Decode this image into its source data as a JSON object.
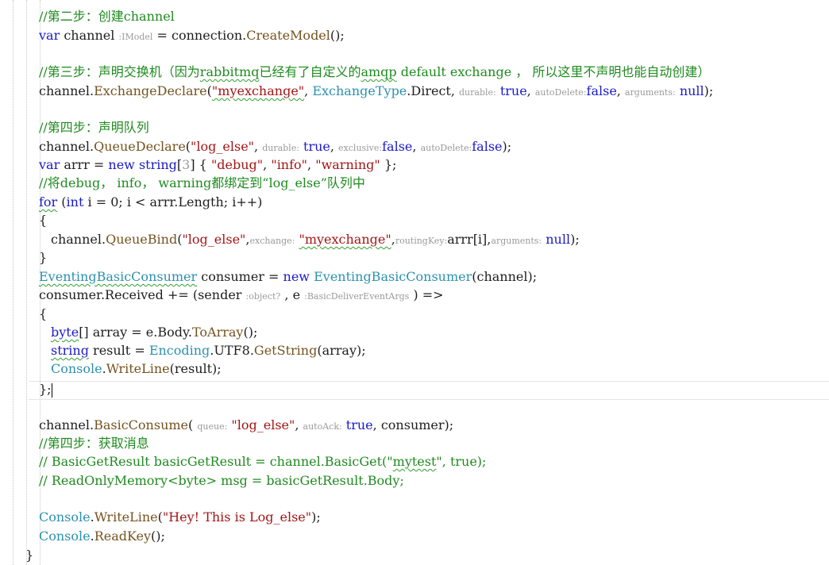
{
  "lines": [
    {
      "t": "//第二步：创建channel"
    },
    {
      "a": "var",
      "b": "channel",
      "c": ":IModel",
      "d": "=",
      "e": "connection",
      "f": "CreateModel",
      "g": "();"
    },
    {
      "t": "//第三步：声明交换机（因为rabbitmq已经有了自定义的amqp default exchange ， 所以这里不声明也能自动创建）",
      "sq1": "rabbitmq",
      "sq2": "amqp"
    },
    {
      "a": "channel",
      "f": "ExchangeDeclare",
      "s1": "\"myexchange\"",
      "ty": "ExchangeType",
      "d": "Direct",
      "h1": "durable:",
      "v1": "true",
      "h2": "autoDelete:",
      "v2": "false",
      "h3": "arguments:",
      "v3": "null"
    },
    {
      "t": "//第四步：声明队列"
    },
    {
      "a": "channel",
      "f": "QueueDeclare",
      "s1": "\"log_else\"",
      "h1": "durable:",
      "v1": "true",
      "h2": "exclusive:",
      "v2": "false",
      "h3": "autoDelete:",
      "v3": "false"
    },
    {
      "a": "var",
      "b": "arrr",
      "c": "new",
      "d": "string",
      "n": "3",
      "s1": "\"debug\"",
      "s2": "\"info\"",
      "s3": "\"warning\""
    },
    {
      "t": "//将debug， info， warning都绑定到“log_else”队列中"
    },
    {
      "a": "for",
      "b": "int",
      "c": "i",
      "n": "0",
      "d": "arrr",
      "e": "Length"
    },
    {
      "t": "{"
    },
    {
      "a": "channel",
      "f": "QueueBind",
      "s1": "\"log_else\"",
      "h1": "exchange:",
      "s2": "\"myexchange\"",
      "h2": "routingKey:",
      "d": "arrr[i]",
      "h3": "arguments:",
      "v3": "null"
    },
    {
      "t": "}"
    },
    {
      "ty": "EventingBasicConsumer",
      "b": "consumer",
      "c": "new",
      "d": "EventingBasicConsumer",
      "e": "channel"
    },
    {
      "a": "consumer",
      "b": "Received",
      "c": "sender",
      "h1": ":object?",
      "d": "e",
      "h2": ":BasicDeliverEventArgs"
    },
    {
      "t": "{"
    },
    {
      "a": "byte",
      "b": "array",
      "c": "e",
      "d": "Body",
      "f": "ToArray"
    },
    {
      "a": "string",
      "b": "result",
      "ty": "Encoding",
      "d": "UTF8",
      "f": "GetString",
      "e": "array"
    },
    {
      "ty": "Console",
      "f": "WriteLine",
      "e": "result"
    },
    {
      "t": "};"
    },
    {
      "a": "channel",
      "f": "BasicConsume",
      "h1": "queue:",
      "s1": "\"log_else\"",
      "h2": "autoAck:",
      "v1": "true",
      "b": "consumer"
    },
    {
      "t": "//第四步：获取消息"
    },
    {
      "t": "// BasicGetResult basicGetResult = channel.BasicGet(\"mytest\", true);",
      "sq1": "mytest"
    },
    {
      "t": "// ReadOnlyMemory<byte> msg = basicGetResult.Body;"
    },
    {
      "ty": "Console",
      "f": "WriteLine",
      "s1": "\"Hey! This is Log_else\""
    },
    {
      "ty": "Console",
      "f": "ReadKey",
      "g": "();"
    },
    {
      "t": "}"
    }
  ]
}
